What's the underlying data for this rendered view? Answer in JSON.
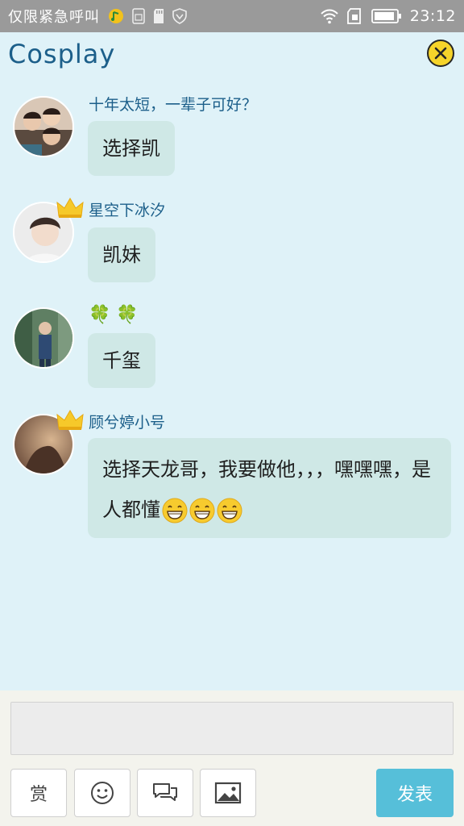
{
  "status_bar": {
    "carrier": "仅限紧急呼叫",
    "time": "23:12"
  },
  "header": {
    "title": "Cosplay"
  },
  "messages": [
    {
      "username": "十年太短，一辈子可好？",
      "text": "选择凯"
    },
    {
      "username": "星空下冰汐",
      "text": "凯妹"
    },
    {
      "username": "🍀 🍀",
      "text": "千玺"
    },
    {
      "username": "顾兮婷小号",
      "text": "选择天龙哥，我要做他，，，嘿嘿嘿，是人都懂"
    }
  ],
  "input": {
    "placeholder": ""
  },
  "toolbar": {
    "reward_label": "赏",
    "send_label": "发表"
  },
  "colors": {
    "background": "#dff2f8",
    "status_bar": "#9a9a9a",
    "title": "#1c5f8a",
    "bubble": "#cfe8e6",
    "send_button": "#56bfd9",
    "close_button": "#f6d42a"
  },
  "icons": [
    "signal-face-icon",
    "sim-icon",
    "sd-card-icon",
    "shield-icon",
    "wifi-icon",
    "sim-card-icon",
    "battery-icon",
    "close-icon",
    "crown-icon",
    "grin-emoji-icon",
    "smiley-icon",
    "chat-bubbles-icon",
    "image-icon"
  ]
}
